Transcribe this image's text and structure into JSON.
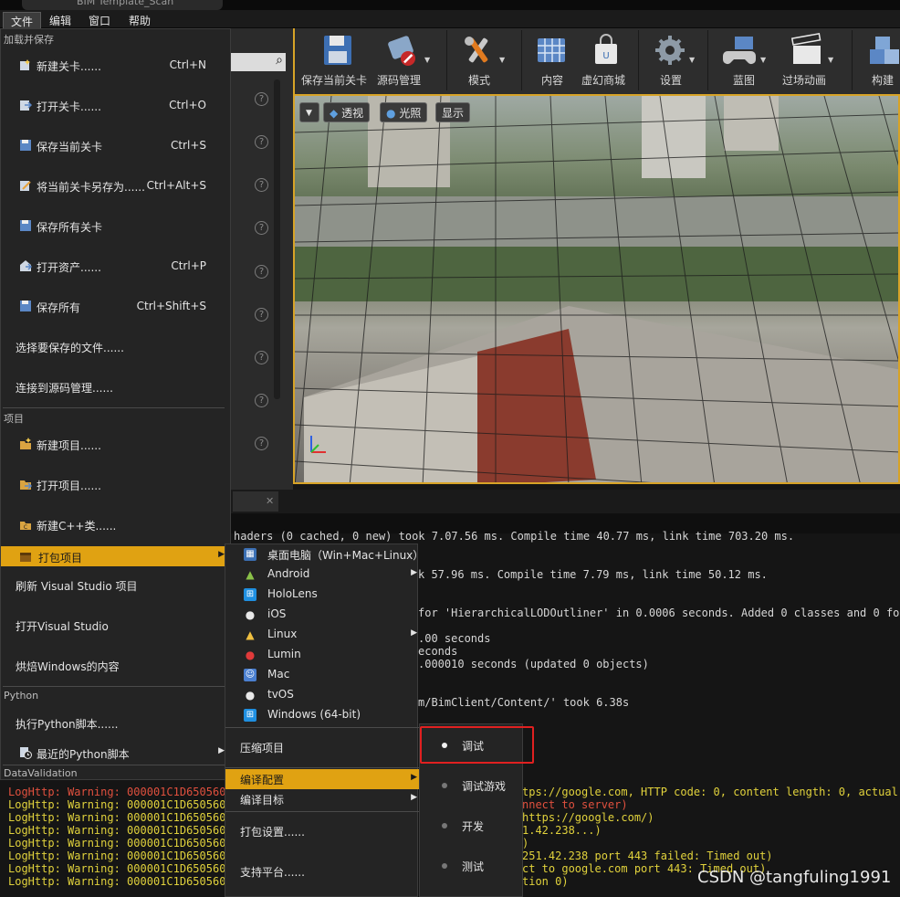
{
  "window": {
    "title_fragment": "BIM Template_Scan"
  },
  "menubar": {
    "file": "文件",
    "edit": "编辑",
    "window": "窗口",
    "help": "帮助"
  },
  "toolbar": {
    "save_level": "保存当前关卡",
    "source_control": "源码管理",
    "modes": "模式",
    "content": "内容",
    "marketplace": "虚幻商城",
    "settings": "设置",
    "blueprints": "蓝图",
    "cinematics": "过场动画",
    "build": "构建"
  },
  "viewport": {
    "view_mode": "透视",
    "lighting": "光照",
    "show": "显示"
  },
  "file_menu": {
    "section_load_save": "加载并保存",
    "new_level": "新建关卡......",
    "new_level_sc": "Ctrl+N",
    "open_level": "打开关卡......",
    "open_level_sc": "Ctrl+O",
    "save_current": "保存当前关卡",
    "save_current_sc": "Ctrl+S",
    "save_as": "将当前关卡另存为......",
    "save_as_sc": "Ctrl+Alt+S",
    "save_all_levels": "保存所有关卡",
    "open_asset": "打开资产......",
    "open_asset_sc": "Ctrl+P",
    "save_all": "保存所有",
    "save_all_sc": "Ctrl+Shift+S",
    "choose_files": "选择要保存的文件......",
    "connect_sc": "连接到源码管理......",
    "section_project": "项目",
    "new_project": "新建项目......",
    "open_project": "打开项目......",
    "new_cpp": "新建C++类......",
    "package_project": "打包项目",
    "refresh_vs": "刷新 Visual Studio 项目",
    "open_vs": "打开Visual Studio",
    "cook_windows": "烘焙Windows的内容",
    "section_python": "Python",
    "exec_python": "执行Python脚本......",
    "recent_python": "最近的Python脚本",
    "section_datavalidation": "DataValidation"
  },
  "package_menu": {
    "desktop": "桌面电脑（Win+Mac+Linux）",
    "android": "Android",
    "hololens": "HoloLens",
    "ios": "iOS",
    "linux": "Linux",
    "lumin": "Lumin",
    "mac": "Mac",
    "tvos": "tvOS",
    "windows": "Windows (64-bit)",
    "zip_project": "压缩项目",
    "build_config": "编译配置",
    "build_target": "编译目标",
    "packaging_settings": "打包设置......",
    "supported_platforms": "支持平台......"
  },
  "config_menu": {
    "debug": "调试",
    "debug_game": "调试游戏",
    "development": "开发",
    "test": "测试"
  },
  "log": {
    "l1": "haders (0 cached, 0 new) took 7.07.56 ms. Compile time 40.77 ms, link time 703.20 ms.",
    "l2": "k 57.96 ms. Compile time 7.79 ms, link time 50.12 ms.",
    "l3": " for 'HierarchicalLODOutliner' in 0.0006 seconds. Added 0 classes and 0 folde",
    "l4": ".00 seconds",
    "l5": "econds",
    "l6": ".000010 seconds (updated 0 objects)",
    "l7": "m/BimClient/Content/' took 6.38s",
    "w1_tail": "tps://google.com, HTTP code: 0, content length: 0, actual pa",
    "w2_tail": "nnect to server)",
    "w3_tail": " https://google.com/)",
    "w4_tail": "1.42.238...)",
    "w5_tail": ")",
    "w6_tail": "251.42.238 port 443 failed: Timed out)",
    "w7_tail": "ct to google.com port 443: Timed out)",
    "w8_tail": "tion 0)",
    "warn_prefix": "LogHttp: Warning: 000001C1D6505600"
  },
  "watermark": "CSDN @tangfuling1991",
  "colors": {
    "accent": "#e0a212",
    "highlight_box": "#e02020",
    "warning": "#e1d23c",
    "error": "#e0503e"
  }
}
